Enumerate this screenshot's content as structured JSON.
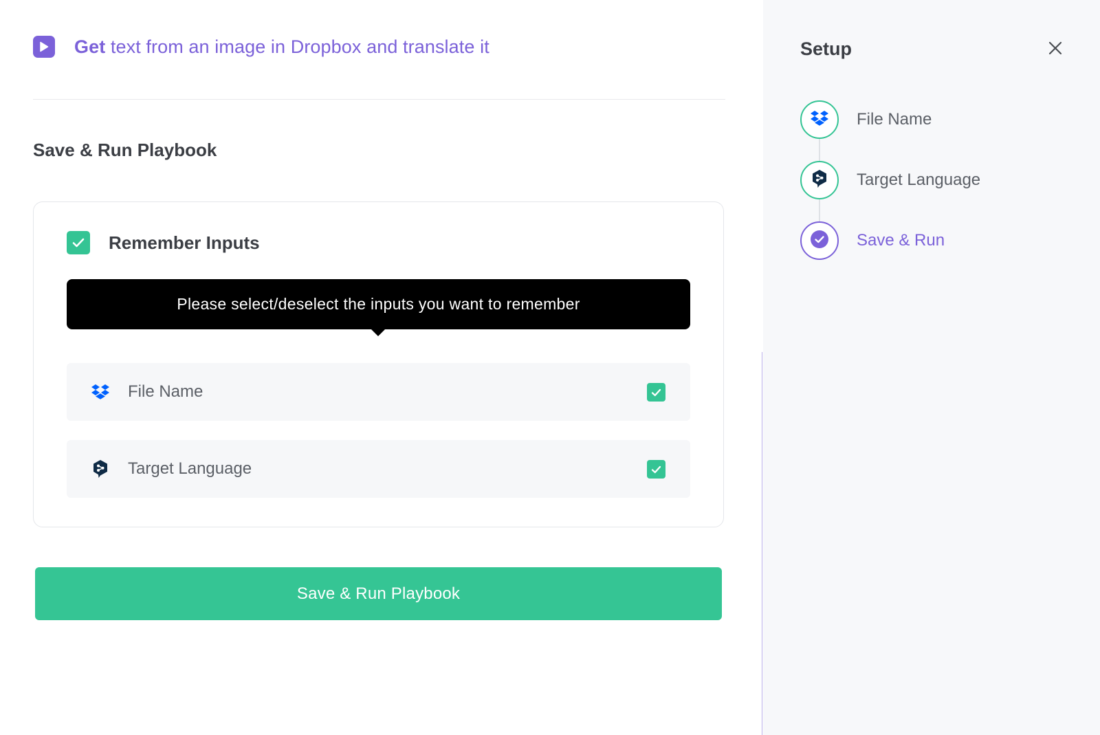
{
  "header": {
    "title_strong": "Get",
    "title_rest": " text from an image in Dropbox and translate it",
    "icon": "play-icon"
  },
  "section": {
    "title": "Save & Run Playbook"
  },
  "remember": {
    "label": "Remember Inputs",
    "checked": true,
    "tooltip": "Please select/deselect the inputs you want to remember",
    "inputs": [
      {
        "label": "File Name",
        "icon": "dropbox-icon",
        "checked": true
      },
      {
        "label": "Target Language",
        "icon": "deepl-icon",
        "checked": true
      }
    ]
  },
  "run_button": {
    "label": "Save & Run Playbook"
  },
  "setup": {
    "title": "Setup",
    "close_icon": "close-icon",
    "steps": [
      {
        "label": "File Name",
        "icon": "dropbox-icon",
        "state": "complete"
      },
      {
        "label": "Target Language",
        "icon": "deepl-icon",
        "state": "complete"
      },
      {
        "label": "Save & Run",
        "icon": "check-circle-icon",
        "state": "active"
      }
    ]
  },
  "colors": {
    "accent": "#7b61d9",
    "success": "#34c494",
    "tooltip_bg": "#000000",
    "dropbox": "#0061fe",
    "deepl": "#0f2b46"
  }
}
